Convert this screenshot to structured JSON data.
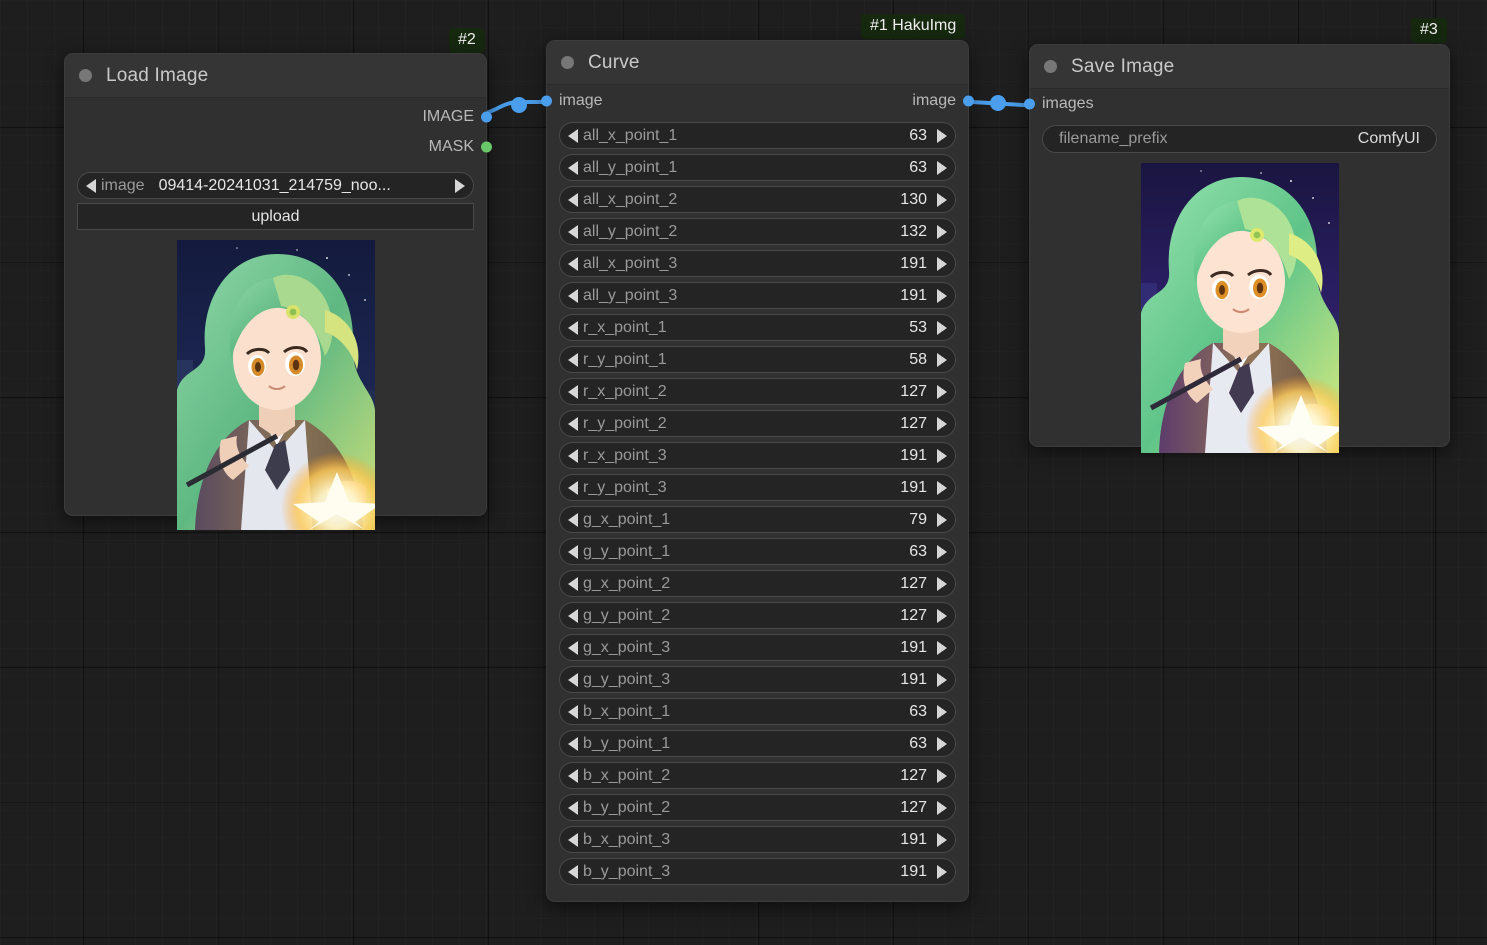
{
  "canvas": {
    "background_color": "#1e1e1e",
    "grid_major_color": "#141414",
    "link_color": "#4a9eeb"
  },
  "nodes": [
    {
      "id": "load-image",
      "badge": "#2",
      "title": "Load Image",
      "outputs": [
        {
          "label": "IMAGE",
          "type_color": "#4a9eeb"
        },
        {
          "label": "MASK",
          "type_color": "#69c96a"
        }
      ],
      "widgets": [
        {
          "kind": "combo",
          "name": "image",
          "value": "09414-20241031_214759_noo..."
        },
        {
          "kind": "button",
          "label": "upload"
        }
      ]
    },
    {
      "id": "curve",
      "badge": "#1 HakuImg",
      "title": "Curve",
      "inputs": [
        {
          "label": "image",
          "type_color": "#4a9eeb"
        }
      ],
      "outputs": [
        {
          "label": "image",
          "type_color": "#4a9eeb"
        }
      ],
      "widgets": [
        {
          "kind": "number",
          "name": "all_x_point_1",
          "value": "63"
        },
        {
          "kind": "number",
          "name": "all_y_point_1",
          "value": "63"
        },
        {
          "kind": "number",
          "name": "all_x_point_2",
          "value": "130"
        },
        {
          "kind": "number",
          "name": "all_y_point_2",
          "value": "132"
        },
        {
          "kind": "number",
          "name": "all_x_point_3",
          "value": "191"
        },
        {
          "kind": "number",
          "name": "all_y_point_3",
          "value": "191"
        },
        {
          "kind": "number",
          "name": "r_x_point_1",
          "value": "53"
        },
        {
          "kind": "number",
          "name": "r_y_point_1",
          "value": "58"
        },
        {
          "kind": "number",
          "name": "r_x_point_2",
          "value": "127"
        },
        {
          "kind": "number",
          "name": "r_y_point_2",
          "value": "127"
        },
        {
          "kind": "number",
          "name": "r_x_point_3",
          "value": "191"
        },
        {
          "kind": "number",
          "name": "r_y_point_3",
          "value": "191"
        },
        {
          "kind": "number",
          "name": "g_x_point_1",
          "value": "79"
        },
        {
          "kind": "number",
          "name": "g_y_point_1",
          "value": "63"
        },
        {
          "kind": "number",
          "name": "g_x_point_2",
          "value": "127"
        },
        {
          "kind": "number",
          "name": "g_y_point_2",
          "value": "127"
        },
        {
          "kind": "number",
          "name": "g_x_point_3",
          "value": "191"
        },
        {
          "kind": "number",
          "name": "g_y_point_3",
          "value": "191"
        },
        {
          "kind": "number",
          "name": "b_x_point_1",
          "value": "63"
        },
        {
          "kind": "number",
          "name": "b_y_point_1",
          "value": "63"
        },
        {
          "kind": "number",
          "name": "b_x_point_2",
          "value": "127"
        },
        {
          "kind": "number",
          "name": "b_y_point_2",
          "value": "127"
        },
        {
          "kind": "number",
          "name": "b_x_point_3",
          "value": "191"
        },
        {
          "kind": "number",
          "name": "b_y_point_3",
          "value": "191"
        }
      ]
    },
    {
      "id": "save-image",
      "badge": "#3",
      "title": "Save Image",
      "inputs": [
        {
          "label": "images",
          "type_color": "#4a9eeb"
        }
      ],
      "widgets": [
        {
          "kind": "text",
          "name": "filename_prefix",
          "value": "ComfyUI"
        }
      ]
    }
  ],
  "links": [
    {
      "from": "load-image.IMAGE",
      "to": "curve.image"
    },
    {
      "from": "curve.image",
      "to": "save-image.images"
    }
  ]
}
